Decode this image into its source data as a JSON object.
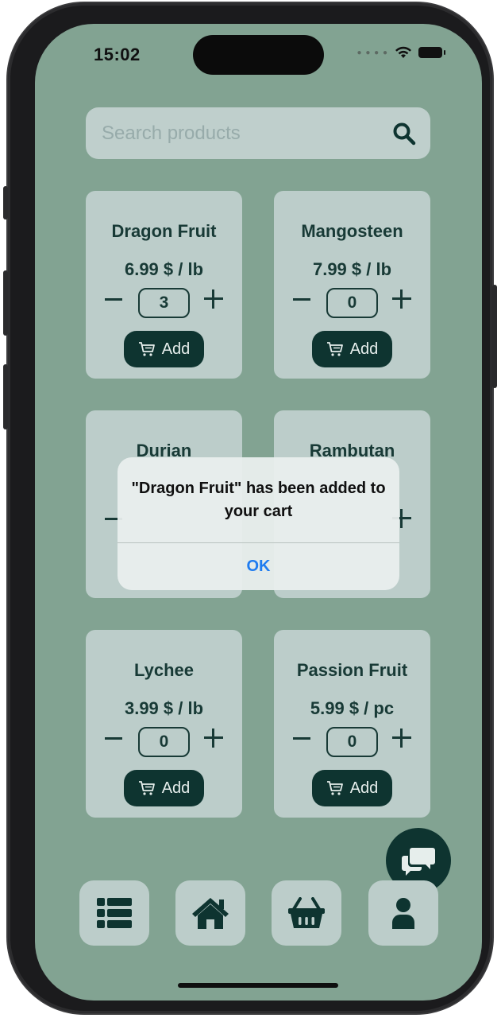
{
  "status_bar": {
    "time": "15:02"
  },
  "search": {
    "placeholder": "Search products"
  },
  "products": [
    {
      "name": "Dragon Fruit",
      "price": "6.99 $ / lb",
      "quantity": "3",
      "add_label": "Add"
    },
    {
      "name": "Mangosteen",
      "price": "7.99 $ / lb",
      "quantity": "0",
      "add_label": "Add"
    },
    {
      "name": "Durian"
    },
    {
      "name": "Rambutan"
    },
    {
      "name": "Lychee",
      "price": "3.99 $ / lb",
      "quantity": "0",
      "add_label": "Add"
    },
    {
      "name": "Passion Fruit",
      "price": "5.99 $ / pc",
      "quantity": "0",
      "add_label": "Add"
    }
  ],
  "alert": {
    "message": "\"Dragon Fruit\" has been added to your cart",
    "ok_label": "OK"
  },
  "bottom_nav": [
    "list-icon",
    "home-icon",
    "basket-icon",
    "person-icon"
  ],
  "colors": {
    "background": "#82a392",
    "card": "#bccdca",
    "accent": "#0e3430",
    "text": "#183a36",
    "link": "#1f7cf0"
  }
}
